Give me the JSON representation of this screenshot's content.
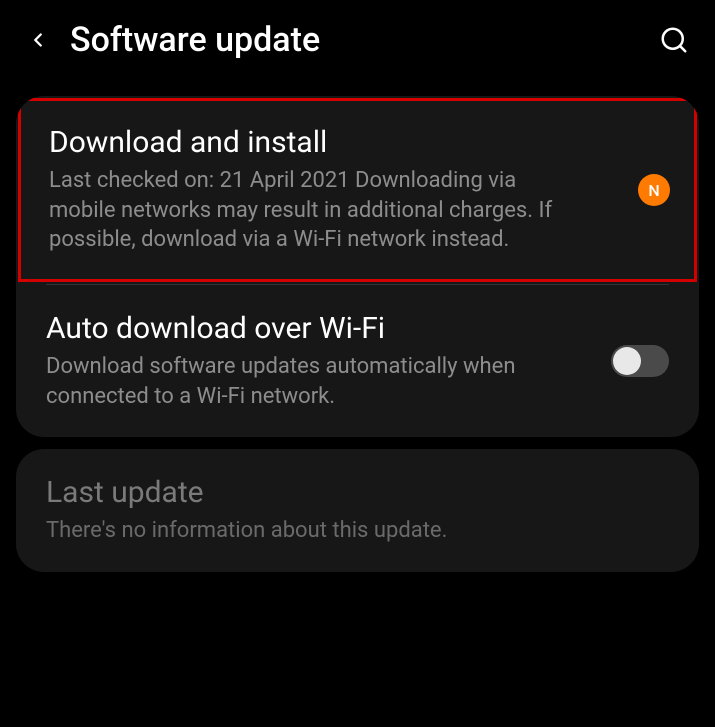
{
  "header": {
    "title": "Software update"
  },
  "sections": {
    "download_install": {
      "title": "Download and install",
      "subtitle": "Last checked on: 21 April 2021\nDownloading via mobile networks may result in additional charges. If possible, download via a Wi-Fi network instead.",
      "badge": "N"
    },
    "auto_download": {
      "title": "Auto download over Wi-Fi",
      "subtitle": "Download software updates automatically when connected to a Wi-Fi network.",
      "toggle_on": false
    },
    "last_update": {
      "title": "Last update",
      "subtitle": "There's no information about this update."
    }
  }
}
